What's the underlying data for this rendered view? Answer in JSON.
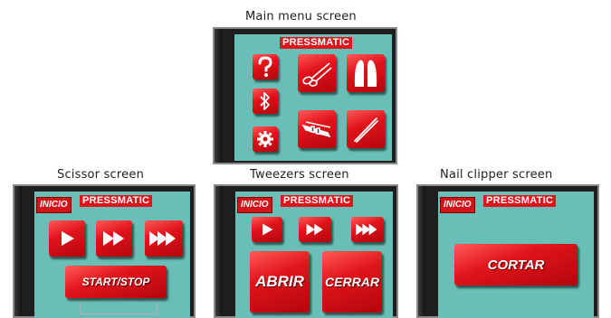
{
  "captions": {
    "main": "Main menu screen",
    "scissor": "Scissor screen",
    "tweezers": "Tweezers screen",
    "nail": "Nail clipper screen"
  },
  "brand": "PRESSMATIC",
  "home_label": "INICIO",
  "main_menu": {
    "buttons": [
      {
        "icon": "question-icon"
      },
      {
        "icon": "bluetooth-icon"
      },
      {
        "icon": "gear-icon"
      },
      {
        "icon": "scissors-icon"
      },
      {
        "icon": "hair-clip-icon"
      },
      {
        "icon": "nail-clipper-icon"
      },
      {
        "icon": "tweezers-icon"
      }
    ]
  },
  "scissor_screen": {
    "speed_buttons": [
      "play-icon",
      "fast-forward-icon",
      "triple-forward-icon"
    ],
    "start_stop_label": "START/STOP"
  },
  "tweezers_screen": {
    "speed_buttons": [
      "play-icon",
      "fast-forward-icon",
      "triple-forward-icon"
    ],
    "open_label": "ABRIR",
    "close_label": "CERRAR"
  },
  "nail_screen": {
    "cut_label": "CORTAR"
  },
  "colors": {
    "screen_bg": "#69bfb7",
    "button_red": "#e1141b",
    "brand_red": "#e0141c",
    "bezel": "#1e1e1e"
  }
}
